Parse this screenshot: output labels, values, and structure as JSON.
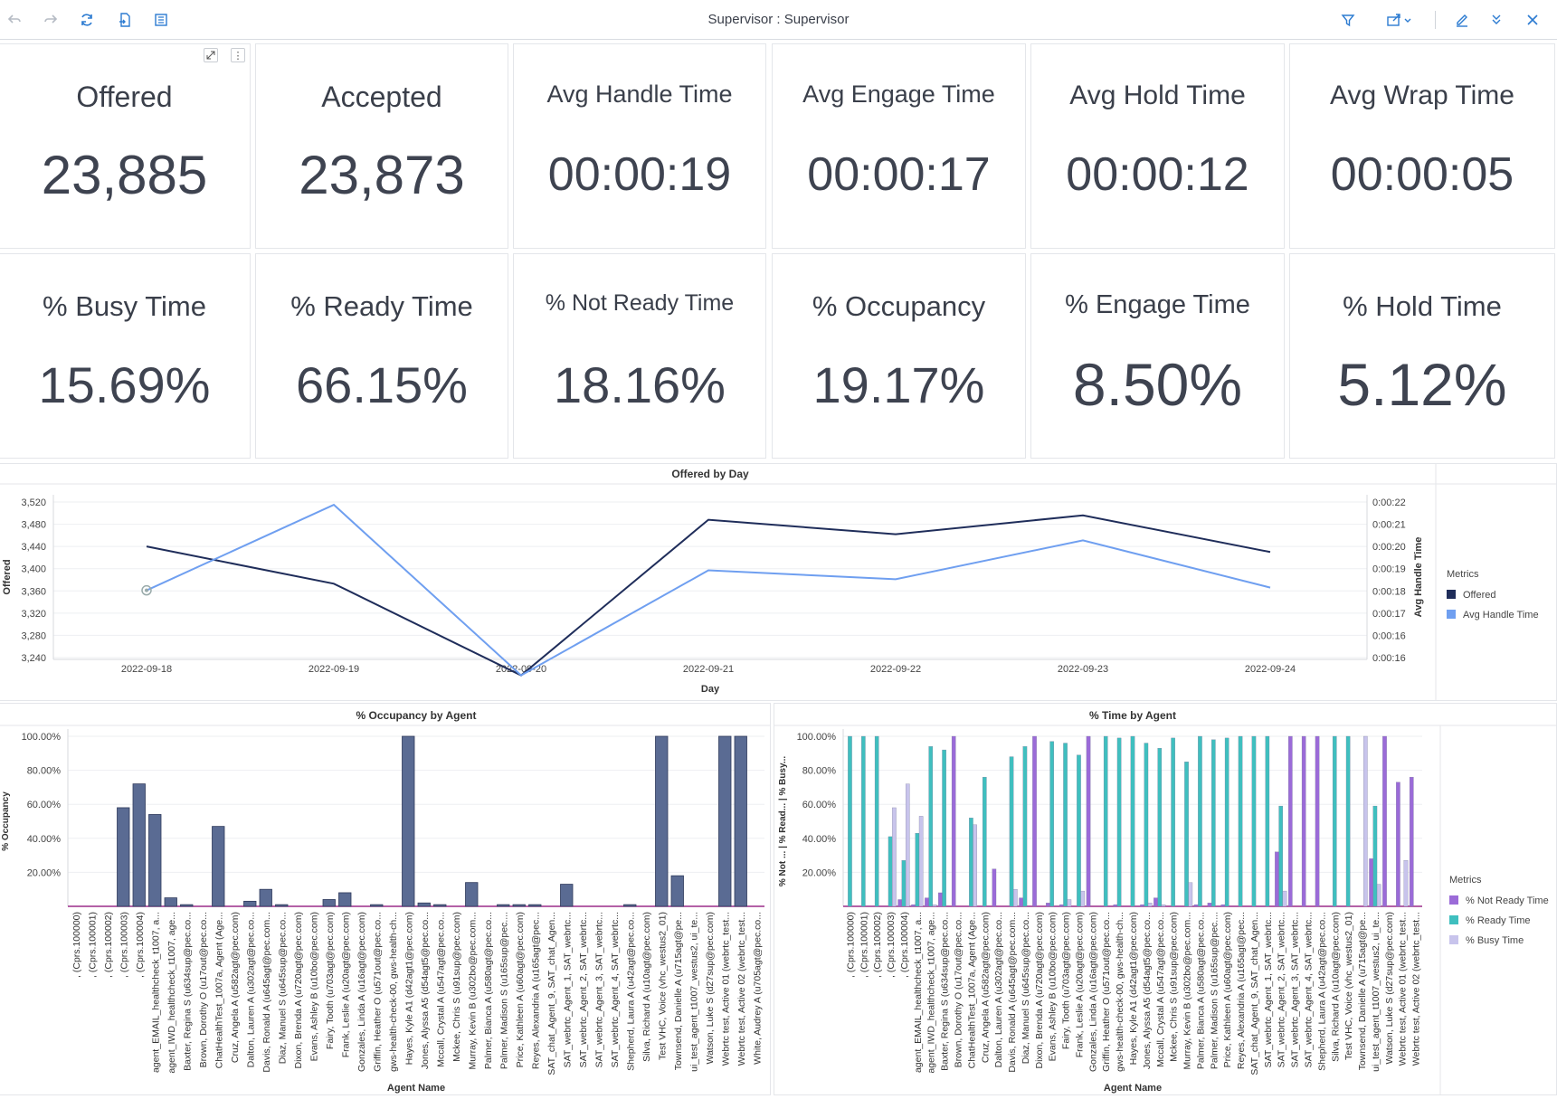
{
  "toolbar": {
    "title": "Supervisor : Supervisor",
    "icons": [
      "undo-icon",
      "redo-icon",
      "refresh-icon",
      "export-page-icon",
      "table-view-icon",
      "filter-icon",
      "share-icon",
      "edit-icon",
      "collapse-icon",
      "close-icon"
    ]
  },
  "tiles_row1": [
    {
      "title": "Offered",
      "value": "23,885"
    },
    {
      "title": "Accepted",
      "value": "23,873"
    },
    {
      "title": "Avg Handle Time",
      "value": "00:00:19"
    },
    {
      "title": "Avg Engage Time",
      "value": "00:00:17"
    },
    {
      "title": "Avg Hold Time",
      "value": "00:00:12"
    },
    {
      "title": "Avg Wrap Time",
      "value": "00:00:05"
    }
  ],
  "tiles_row2": [
    {
      "title": "% Busy Time",
      "value": "15.69%"
    },
    {
      "title": "% Ready Time",
      "value": "66.15%"
    },
    {
      "title": "% Not Ready Time",
      "value": "18.16%"
    },
    {
      "title": "% Occupancy",
      "value": "19.17%"
    },
    {
      "title": "% Engage Time",
      "value": "8.50%"
    },
    {
      "title": "% Hold Time",
      "value": "5.12%"
    }
  ],
  "colors": {
    "offered": "#1f2d5a",
    "avg_handle": "#6f9ff0",
    "occupancy_bar": "#5a6b93",
    "not_ready": "#9b6bd8",
    "ready": "#3fbfbf",
    "busy": "#c8c4ec"
  },
  "chart_data": [
    {
      "type": "line",
      "title": "Offered by Day",
      "xlabel": "Day",
      "ylabel": "Offered",
      "y2label": "Avg Handle Time",
      "x": [
        "2022-09-18",
        "2022-09-19",
        "2022-09-20",
        "2022-09-21",
        "2022-09-22",
        "2022-09-23",
        "2022-09-24"
      ],
      "ylim": [
        3200,
        3530
      ],
      "yticks": [
        "3,520",
        "3,480",
        "3,440",
        "3,400",
        "3,360",
        "3,320",
        "3,280",
        "3,240"
      ],
      "y2ticks": [
        "0:00:22",
        "0:00:21",
        "0:00:20",
        "0:00:19",
        "0:00:18",
        "0:00:17",
        "0:00:16",
        "0:00:16"
      ],
      "legend_title": "Metrics",
      "series": [
        {
          "name": "Offered",
          "values": [
            3440,
            3373,
            3208,
            3488,
            3462,
            3496,
            3430
          ]
        },
        {
          "name": "Avg Handle Time",
          "values": [
            3361,
            3515,
            3208,
            3397,
            3381,
            3451,
            3366
          ]
        }
      ]
    },
    {
      "type": "bar",
      "title": "% Occupancy by Agent",
      "xlabel": "Agent Name",
      "ylabel": "% Occupancy",
      "yticks": [
        "100.00%",
        "80.00%",
        "60.00%",
        "40.00%",
        "20.00%"
      ],
      "ylim": [
        0,
        100
      ],
      "categories": [
        ", (Cprs.100000)",
        ", (Cprs.100001)",
        ", (Cprs.100002)",
        ", (Cprs.100003)",
        ", (Cprs.100004)",
        "agent_EMAIL_healthcheck_t1007, a...",
        "agent_IWD_healthcheck_t1007, age...",
        "Baxter, Regina S (u634sup@pec.co...",
        "Brown, Dorothy O (u17out@pec.co...",
        "ChatHealthTest_1007a, Agent (Age...",
        "Cruz, Angela A (u582agt@pec.com)",
        "Dalton, Lauren A (u302agt@pec.co...",
        "Davis, Ronald A (u645agt@pec.com...",
        "Diaz, Manuel S (u645sup@pec.co...",
        "Dixon, Brenda A (u720agt@pec.com)",
        "Evans, Ashley B (u10bo@pec.com)",
        "Fairy, Tooth (u703agt@pec.com)",
        "Frank, Leslie A (u20agt@pec.com)",
        "Gonzales, Linda A (u16agt@pec.com)",
        "Griffin, Heather O (u571out@pec.co...",
        "gws-health-check-00, gws-health-ch...",
        "Hayes, Kyle A1 (d42agt1@pec.com)",
        "Jones, Alyssa A5 (d54agt5@pec.co...",
        "Mccall, Crystal A (u547agt@pec.co...",
        "Mckee, Chris S (u91sup@pec.com)",
        "Murray, Kevin B (u302bo@pec.com...",
        "Palmer, Bianca A (u580agt@pec.co...",
        "Palmer, Madison S (u165sup@pec....",
        "Price, Kathleen A (u60agt@pec.com)",
        "Reyes, Alexandria A (u165agt@pec...",
        "SAT_chat_Agent_9, SAT_chat_Agen...",
        "SAT_webrtc_Agent_1, SAT_webrtc...",
        "SAT_webrtc_Agent_2, SAT_webrtc...",
        "SAT_webrtc_Agent_3, SAT_webrtc...",
        "SAT_webrtc_Agent_4, SAT_webrtc...",
        "Shepherd, Laura A (u42agt@pec.co...",
        "Silva, Richard A (u10agt@pec.com)",
        "Test VHC, Voice (vhc_westus2_01)",
        "Townsend, Danielle A (u715agt@pe...",
        "ui_test_agent_t1007_westus2, ui_te...",
        "Watson, Luke S (d27sup@pec.com)",
        "Webrtc test, Active 01 (webrtc_test...",
        "Webrtc test, Active 02 (webrtc_test...",
        "White, Audrey A (u705agt@pec.co..."
      ],
      "values": [
        0,
        0,
        0,
        58,
        72,
        54,
        5,
        1,
        0,
        47,
        0,
        3,
        10,
        1,
        0,
        0,
        4,
        8,
        0,
        1,
        0,
        100,
        2,
        1,
        0,
        14,
        0,
        1,
        1,
        1,
        0,
        13,
        0,
        0,
        0,
        1,
        0,
        100,
        18,
        0,
        0,
        100,
        100,
        0
      ]
    },
    {
      "type": "bar",
      "title": "% Time by Agent",
      "xlabel": "Agent Name",
      "ylabel": "% Not ...  |  % Read...  |  % Busy...",
      "yticks": [
        "100.00%",
        "80.00%",
        "60.00%",
        "40.00%",
        "20.00%"
      ],
      "ylim": [
        0,
        100
      ],
      "legend_title": "Metrics",
      "categories": [
        ", (Cprs.100000)",
        ", (Cprs.100001)",
        ", (Cprs.100002)",
        ", (Cprs.100003)",
        ", (Cprs.100004)",
        "agent_EMAIL_healthcheck_t1007, a...",
        "agent_IWD_healthcheck_t1007, age...",
        "Baxter, Regina S (u634sup@pec.co...",
        "Brown, Dorothy O (u17out@pec.co...",
        "ChatHealthTest_1007a, Agent (Age...",
        "Cruz, Angela A (u582agt@pec.com)",
        "Dalton, Lauren A (u302agt@pec.co...",
        "Davis, Ronald A (u645agt@pec.com...",
        "Diaz, Manuel S (u645sup@pec.co...",
        "Dixon, Brenda A (u720agt@pec.com)",
        "Evans, Ashley B (u10bo@pec.com)",
        "Fairy, Tooth (u703agt@pec.com)",
        "Frank, Leslie A (u20agt@pec.com)",
        "Gonzales, Linda A (u16agt@pec.com)",
        "Griffin, Heather O (u571out@pec.co...",
        "gws-health-check-00, gws-health-ch...",
        "Hayes, Kyle A1 (d42agt1@pec.com)",
        "Jones, Alyssa A5 (d54agt5@pec.co...",
        "Mccall, Crystal A (u547agt@pec.co...",
        "Mckee, Chris S (u91sup@pec.com)",
        "Murray, Kevin B (u302bo@pec.com...",
        "Palmer, Bianca A (u580agt@pec.co...",
        "Palmer, Madison S (u165sup@pec....",
        "Price, Kathleen A (u60agt@pec.com)",
        "Reyes, Alexandria A (u165agt@pec...",
        "SAT_chat_Agent_9, SAT_chat_Agen...",
        "SAT_webrtc_Agent_1, SAT_webrtc...",
        "SAT_webrtc_Agent_2, SAT_webrtc...",
        "SAT_webrtc_Agent_3, SAT_webrtc...",
        "SAT_webrtc_Agent_4, SAT_webrtc...",
        "Shepherd, Laura A (u42agt@pec.co...",
        "Silva, Richard A (u10agt@pec.com)",
        "Test VHC, Voice (vhc_westus2_01)",
        "Townsend, Danielle A (u715agt@pe...",
        "ui_test_agent_t1007_westus2, ui_te...",
        "Watson, Luke S (d27sup@pec.com)",
        "Webrtc test, Active 01 (webrtc_test...",
        "Webrtc test, Active 02 (webrtc_test..."
      ],
      "series": [
        {
          "name": "% Not Ready Time",
          "values": [
            0,
            0,
            0,
            0,
            4,
            1,
            5,
            8,
            100,
            0,
            0,
            22,
            0,
            5,
            100,
            2,
            1,
            0,
            100,
            0,
            1,
            0,
            1,
            5,
            0,
            0,
            1,
            2,
            1,
            0,
            0,
            0,
            32,
            100,
            100,
            100,
            0,
            0,
            0,
            28,
            100,
            73,
            76
          ]
        },
        {
          "name": "% Ready Time",
          "values": [
            100,
            100,
            100,
            41,
            27,
            43,
            94,
            92,
            0,
            52,
            76,
            0,
            88,
            94,
            0,
            97,
            96,
            89,
            0,
            100,
            99,
            100,
            96,
            93,
            99,
            85,
            100,
            98,
            99,
            100,
            100,
            100,
            59,
            0,
            0,
            0,
            100,
            100,
            0,
            59,
            0,
            0,
            0
          ]
        },
        {
          "name": "% Busy Time",
          "values": [
            0,
            0,
            0,
            58,
            72,
            53,
            1,
            0,
            0,
            48,
            0,
            0,
            10,
            0,
            0,
            0,
            4,
            9,
            0,
            0,
            0,
            0,
            2,
            1,
            0,
            14,
            0,
            0,
            0,
            0,
            0,
            0,
            9,
            0,
            0,
            0,
            0,
            0,
            100,
            13,
            0,
            27,
            0
          ]
        }
      ]
    }
  ]
}
